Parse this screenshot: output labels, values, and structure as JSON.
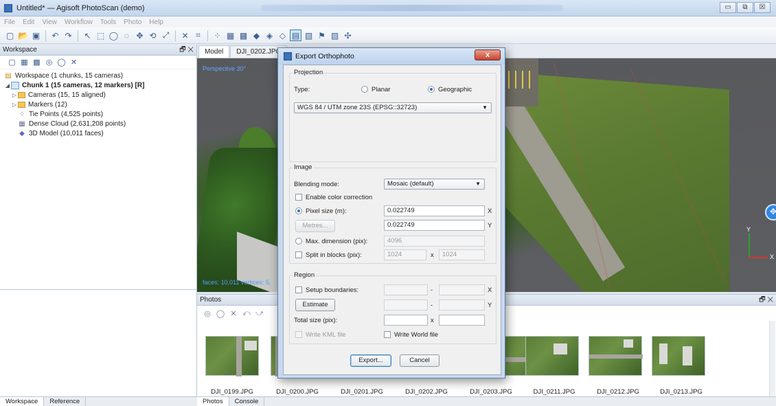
{
  "window": {
    "title": "Untitled* — Agisoft PhotoScan (demo)",
    "controls": [
      "▭",
      "⧉",
      "☒"
    ]
  },
  "menu": [
    "File",
    "Edit",
    "View",
    "Workflow",
    "Tools",
    "Photo",
    "Help"
  ],
  "workspace": {
    "header": "Workspace",
    "header_controls": "🗗 ✕",
    "tree": [
      {
        "label": "Workspace (1 chunks, 15 cameras)",
        "bold": false
      },
      {
        "label": "Chunk 1 (15 cameras, 12 markers) [R]",
        "bold": true
      },
      {
        "label": "Cameras (15, 15 aligned)",
        "bold": false
      },
      {
        "label": "Markers (12)",
        "bold": false
      },
      {
        "label": "Tie Points (4,525 points)",
        "bold": false
      },
      {
        "label": "Dense Cloud (2,631,208 points)",
        "bold": false
      },
      {
        "label": "3D Model (10,011 faces)",
        "bold": false
      }
    ],
    "bottom_tabs": [
      "Workspace",
      "Reference"
    ]
  },
  "model_tabs": [
    "Model",
    "DJI_0202.JPG"
  ],
  "viewport": {
    "perspective_label": "Perspective 30°",
    "faces_label": "faces: 10,011 vertices: 5,",
    "axis_y": "Y",
    "axis_x": "X"
  },
  "photos": {
    "header": "Photos",
    "header_controls": "🗗 ✕",
    "thumbnails": [
      "DJI_0199.JPG",
      "DJI_0200.JPG",
      "DJI_0201.JPG",
      "DJI_0202.JPG",
      "DJI_0203.JPG",
      "DJI_0211.JPG",
      "DJI_0212.JPG",
      "DJI_0213.JPG"
    ],
    "bottom_tabs": [
      "Photos",
      "Console"
    ]
  },
  "dialog": {
    "title": "Export Orthophoto",
    "close": "x",
    "projection": {
      "group_label": "Projection",
      "type_label": "Type:",
      "planar_label": "Planar",
      "geographic_label": "Geographic",
      "selected": "geographic",
      "crs": "WGS 84 / UTM zone 23S (EPSG::32723)"
    },
    "image": {
      "group_label": "Image",
      "blending_label": "Blending mode:",
      "blending_value": "Mosaic (default)",
      "color_correction_label": "Enable color correction",
      "pixel_size_label": "Pixel size (m):",
      "pixel_size_x": "0.022749",
      "pixel_size_y": "0.022749",
      "metres_button": "Metres...",
      "max_dimension_label": "Max. dimension (pix):",
      "max_dimension_value": "4096",
      "split_blocks_label": "Split in blocks (pix):",
      "split_x": "1024",
      "split_y": "1024",
      "x_suffix": "X",
      "y_suffix": "Y",
      "times": "x"
    },
    "region": {
      "group_label": "Region",
      "setup_boundaries_label": "Setup boundaries:",
      "estimate_button": "Estimate",
      "total_size_label": "Total size (pix):",
      "dash": "-",
      "times": "x",
      "x_suffix": "X",
      "y_suffix": "Y",
      "write_kml_label": "Write KML file",
      "write_world_label": "Write World file"
    },
    "export_button": "Export...",
    "cancel_button": "Cancel"
  }
}
